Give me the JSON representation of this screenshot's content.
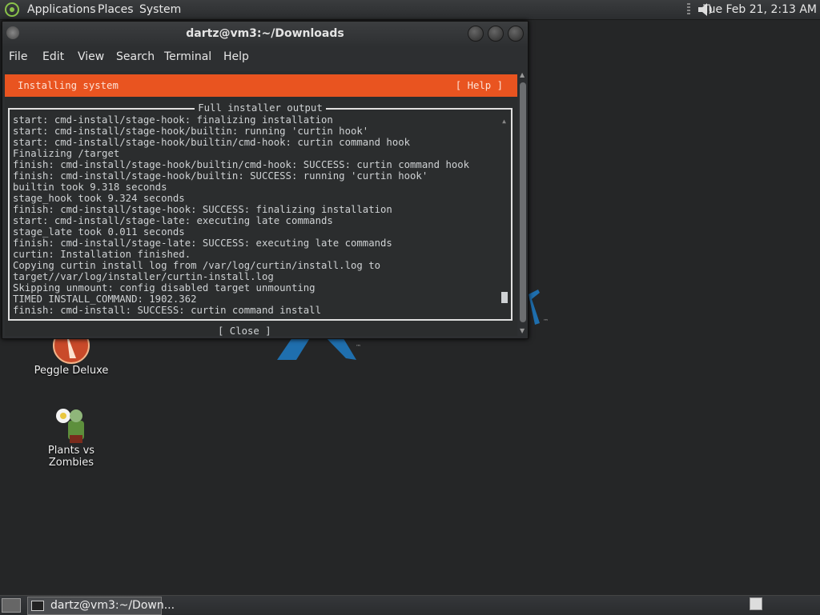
{
  "top_panel": {
    "menus": [
      "Applications",
      "Places",
      "System"
    ],
    "clock": "Tue Feb 21,  2:13 AM"
  },
  "desktop": {
    "icons": [
      {
        "label": "Peggle Deluxe",
        "icon": "peggle-icon"
      },
      {
        "label": "Plants vs Zombies",
        "icon": "plants-vs-zombies-icon"
      }
    ],
    "wallpaper_marks": [
      "™",
      "™"
    ]
  },
  "window": {
    "title": "dartz@vm3:~/Downloads",
    "menu": [
      "File",
      "Edit",
      "View",
      "Search",
      "Terminal",
      "Help"
    ]
  },
  "installer": {
    "header": "Installing system",
    "help": "[ Help ]",
    "frame_title": "Full installer output",
    "log": [
      "start: cmd-install/stage-hook: finalizing installation",
      "start: cmd-install/stage-hook/builtin: running 'curtin hook'",
      "start: cmd-install/stage-hook/builtin/cmd-hook: curtin command hook",
      "Finalizing /target",
      "finish: cmd-install/stage-hook/builtin/cmd-hook: SUCCESS: curtin command hook",
      "finish: cmd-install/stage-hook/builtin: SUCCESS: running 'curtin hook'",
      "builtin took 9.318 seconds",
      "stage_hook took 9.324 seconds",
      "finish: cmd-install/stage-hook: SUCCESS: finalizing installation",
      "start: cmd-install/stage-late: executing late commands",
      "stage_late took 0.011 seconds",
      "finish: cmd-install/stage-late: SUCCESS: executing late commands",
      "curtin: Installation finished.",
      "Copying curtin install log from /var/log/curtin/install.log to",
      "target//var/log/installer/curtin-install.log",
      "Skipping unmount: config disabled target unmounting",
      "TIMED INSTALL_COMMAND: 1902.362",
      "finish: cmd-install: SUCCESS: curtin command install"
    ],
    "close": "[ Close      ]",
    "accent_color": "#e95420"
  },
  "taskbar": {
    "task_label": "dartz@vm3:~/Down..."
  }
}
